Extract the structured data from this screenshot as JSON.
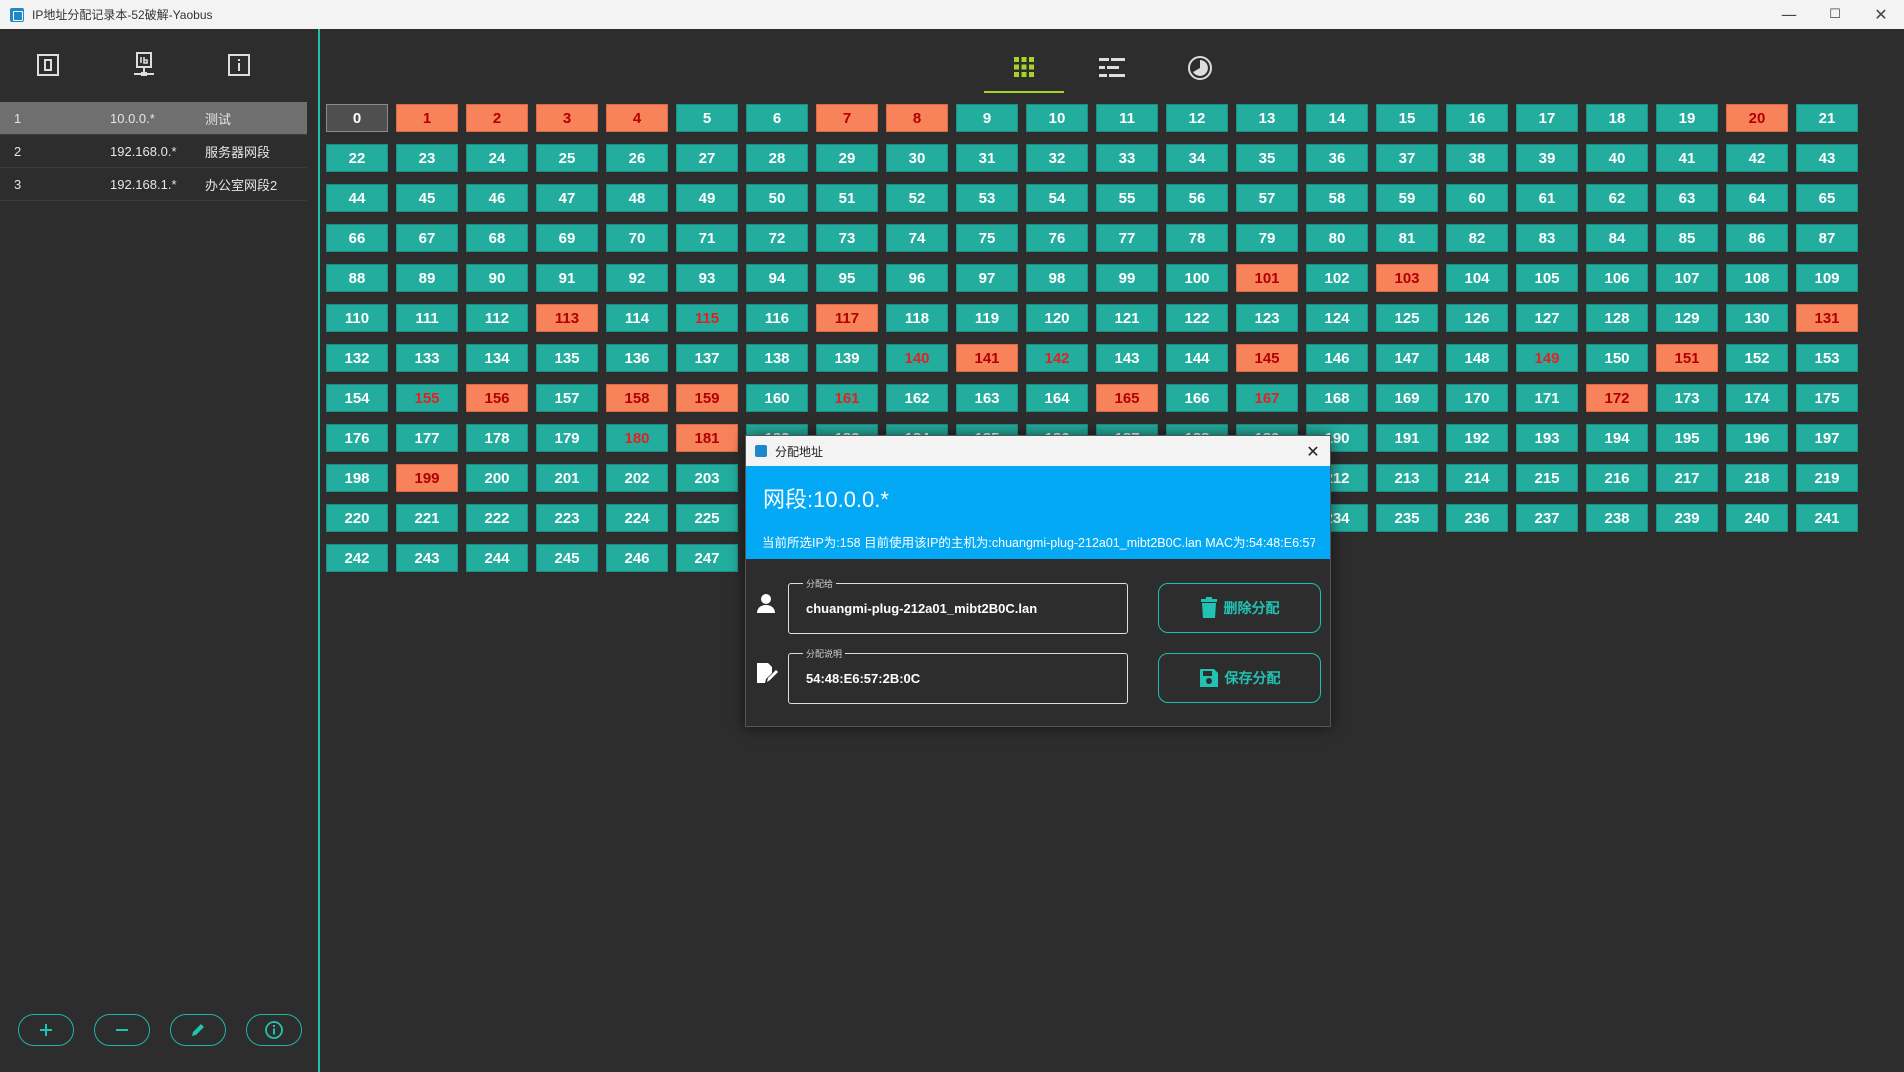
{
  "window": {
    "title": "IP地址分配记录本-52破解-Yaobus",
    "minimize": "—",
    "maximize": "☐",
    "close": "✕"
  },
  "sidebar": {
    "toolbar": [
      "zero-icon",
      "ip-network-icon",
      "info-icon"
    ],
    "segments": [
      {
        "id": "1",
        "prefix": "10.0.0.*",
        "name": "测试",
        "selected": true
      },
      {
        "id": "2",
        "prefix": "192.168.0.*",
        "name": "服务器网段",
        "selected": false
      },
      {
        "id": "3",
        "prefix": "192.168.1.*",
        "name": "办公室网段2",
        "selected": false
      }
    ],
    "bottom_buttons": [
      "add-icon",
      "remove-icon",
      "edit-icon",
      "info-icon"
    ]
  },
  "tabs": [
    {
      "icon": "grid-icon",
      "active": true
    },
    {
      "icon": "list-icon",
      "active": false
    },
    {
      "icon": "pie-chart-icon",
      "active": false
    }
  ],
  "grid": {
    "count": 248,
    "columns": 22,
    "used": [
      1,
      2,
      3,
      4,
      7,
      8,
      20,
      101,
      103,
      113,
      117,
      131,
      141,
      145,
      151,
      156,
      158,
      159,
      165,
      172,
      181,
      199
    ],
    "warn": [
      115,
      140,
      142,
      149,
      155,
      161,
      167,
      180
    ],
    "selected": 0
  },
  "dialog": {
    "title": "分配地址",
    "close": "✕",
    "segment_heading": "网段:10.0.0.*",
    "info": "当前所选IP为:158 目前使用该IP的主机为:chuangmi-plug-212a01_mibt2B0C.lan MAC为:54:48:E6:57:2B:0C",
    "assignee_label": "分配给",
    "assignee_value": "chuangmi-plug-212a01_mibt2B0C.lan",
    "note_label": "分配说明",
    "note_value": "54:48:E6:57:2B:0C",
    "delete_label": "删除分配",
    "save_label": "保存分配"
  },
  "colors": {
    "teal": "#23ad9f",
    "used": "#f8835b",
    "accent": "#a8d22a",
    "banner": "#03a9f4"
  }
}
